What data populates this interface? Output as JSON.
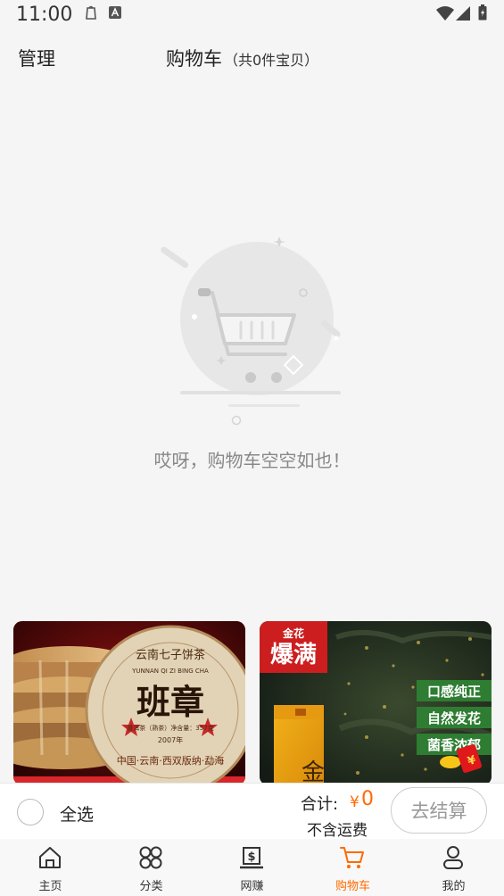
{
  "status_bar": {
    "time": "11:00"
  },
  "header": {
    "manage_label": "管理",
    "title": "购物车",
    "count_text": "（共0件宝贝）"
  },
  "empty": {
    "message": "哎呀，购物车空空如也！"
  },
  "cards": [
    {
      "tea_name": "云南七子饼茶",
      "pinyin": "YUNNAN QI ZI BING CHA",
      "big_text": "班章",
      "small_text": "普洱茶（熟茶）净含量：357克",
      "year_text": "2007年",
      "ring_text": "中国·云南·西双版纳·勐海"
    },
    {
      "badge_small": "金花",
      "badge_big": "爆满",
      "tags": [
        "口感纯正",
        "自然发花",
        "菌香浓郁"
      ],
      "box_char": "金"
    }
  ],
  "bottom_bar": {
    "select_all_label": "全选",
    "total_label": "合计:",
    "currency": "¥",
    "total_value": "0",
    "shipping_note": "不含运费",
    "checkout_label": "去结算"
  },
  "tabs": [
    {
      "label": "主页",
      "icon": "home-icon",
      "active": false
    },
    {
      "label": "分类",
      "icon": "category-icon",
      "active": false
    },
    {
      "label": "网赚",
      "icon": "earn-icon",
      "active": false
    },
    {
      "label": "购物车",
      "icon": "cart-icon",
      "active": true
    },
    {
      "label": "我的",
      "icon": "profile-icon",
      "active": false
    }
  ],
  "colors": {
    "accent": "#ff6a00",
    "background": "#f5f5f5",
    "inactive_button": "#999999"
  }
}
